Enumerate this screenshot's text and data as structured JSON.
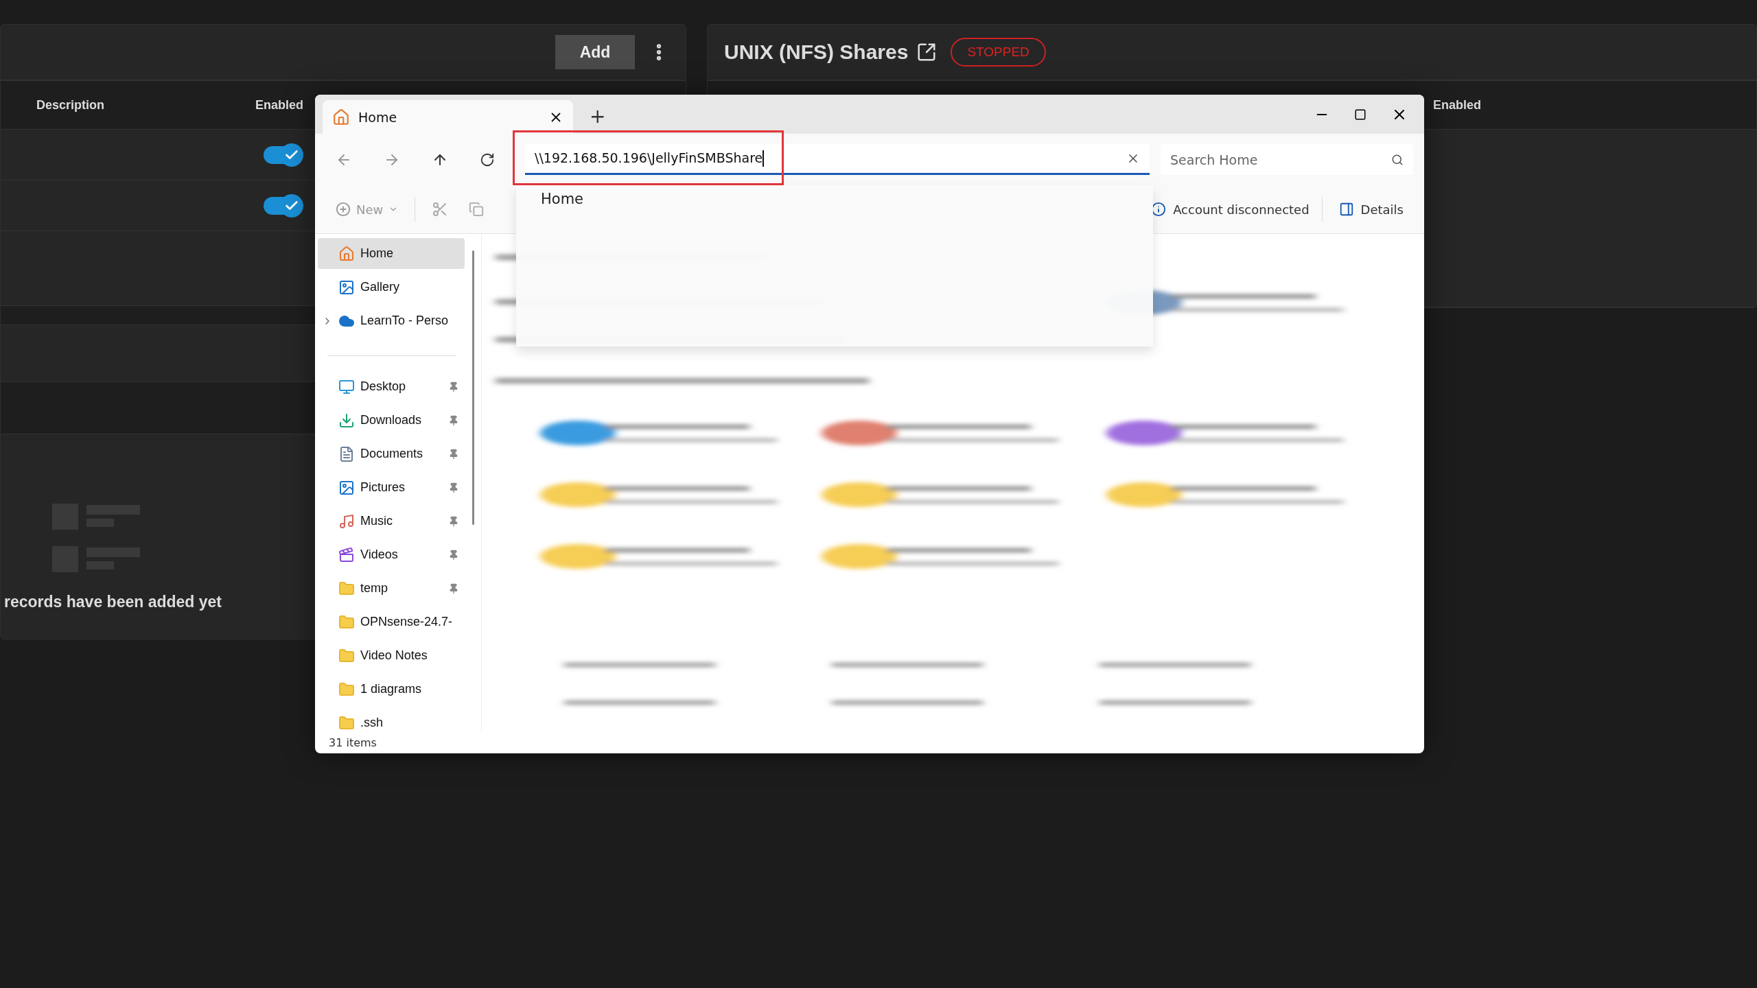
{
  "left_panel": {
    "add_button": "Add",
    "columns": [
      "Description",
      "Enabled"
    ],
    "rows": [
      {
        "enabled": true
      },
      {
        "enabled": true
      }
    ],
    "empty_message": "records have been added yet"
  },
  "right_panel": {
    "title": "UNIX (NFS) Shares",
    "status": "STOPPED",
    "columns": [
      "Enabled"
    ]
  },
  "explorer": {
    "tab": {
      "title": "Home",
      "selected": true
    },
    "new_tab": "+",
    "address": "\\\\192.168.50.196\\JellyFinSMBShare",
    "suggestions": [
      "Home"
    ],
    "search": {
      "placeholder": "Search Home"
    },
    "new_button": "New",
    "account_status": "Account disconnected",
    "details_button": "Details",
    "sidebar": [
      {
        "label": "Home",
        "kind": "home",
        "selected": true,
        "pinned": false,
        "expandable": false
      },
      {
        "label": "Gallery",
        "kind": "gallery",
        "selected": false,
        "pinned": false,
        "expandable": false
      },
      {
        "label": "LearnTo - Perso",
        "kind": "cloud",
        "selected": false,
        "pinned": false,
        "expandable": true
      },
      {
        "label": "Desktop",
        "kind": "desktop",
        "selected": false,
        "pinned": true,
        "expandable": false
      },
      {
        "label": "Downloads",
        "kind": "downloads",
        "selected": false,
        "pinned": true,
        "expandable": false
      },
      {
        "label": "Documents",
        "kind": "documents",
        "selected": false,
        "pinned": true,
        "expandable": false
      },
      {
        "label": "Pictures",
        "kind": "pictures",
        "selected": false,
        "pinned": true,
        "expandable": false
      },
      {
        "label": "Music",
        "kind": "music",
        "selected": false,
        "pinned": true,
        "expandable": false
      },
      {
        "label": "Videos",
        "kind": "videos",
        "selected": false,
        "pinned": true,
        "expandable": false
      },
      {
        "label": "temp",
        "kind": "folder",
        "selected": false,
        "pinned": true,
        "expandable": false
      },
      {
        "label": "OPNsense-24.7-",
        "kind": "folder",
        "selected": false,
        "pinned": false,
        "expandable": false
      },
      {
        "label": "Video Notes",
        "kind": "folder",
        "selected": false,
        "pinned": false,
        "expandable": false
      },
      {
        "label": "1 diagrams",
        "kind": "folder",
        "selected": false,
        "pinned": false,
        "expandable": false
      },
      {
        "label": ".ssh",
        "kind": "folder",
        "selected": false,
        "pinned": false,
        "expandable": false
      }
    ],
    "status": "31 items"
  }
}
